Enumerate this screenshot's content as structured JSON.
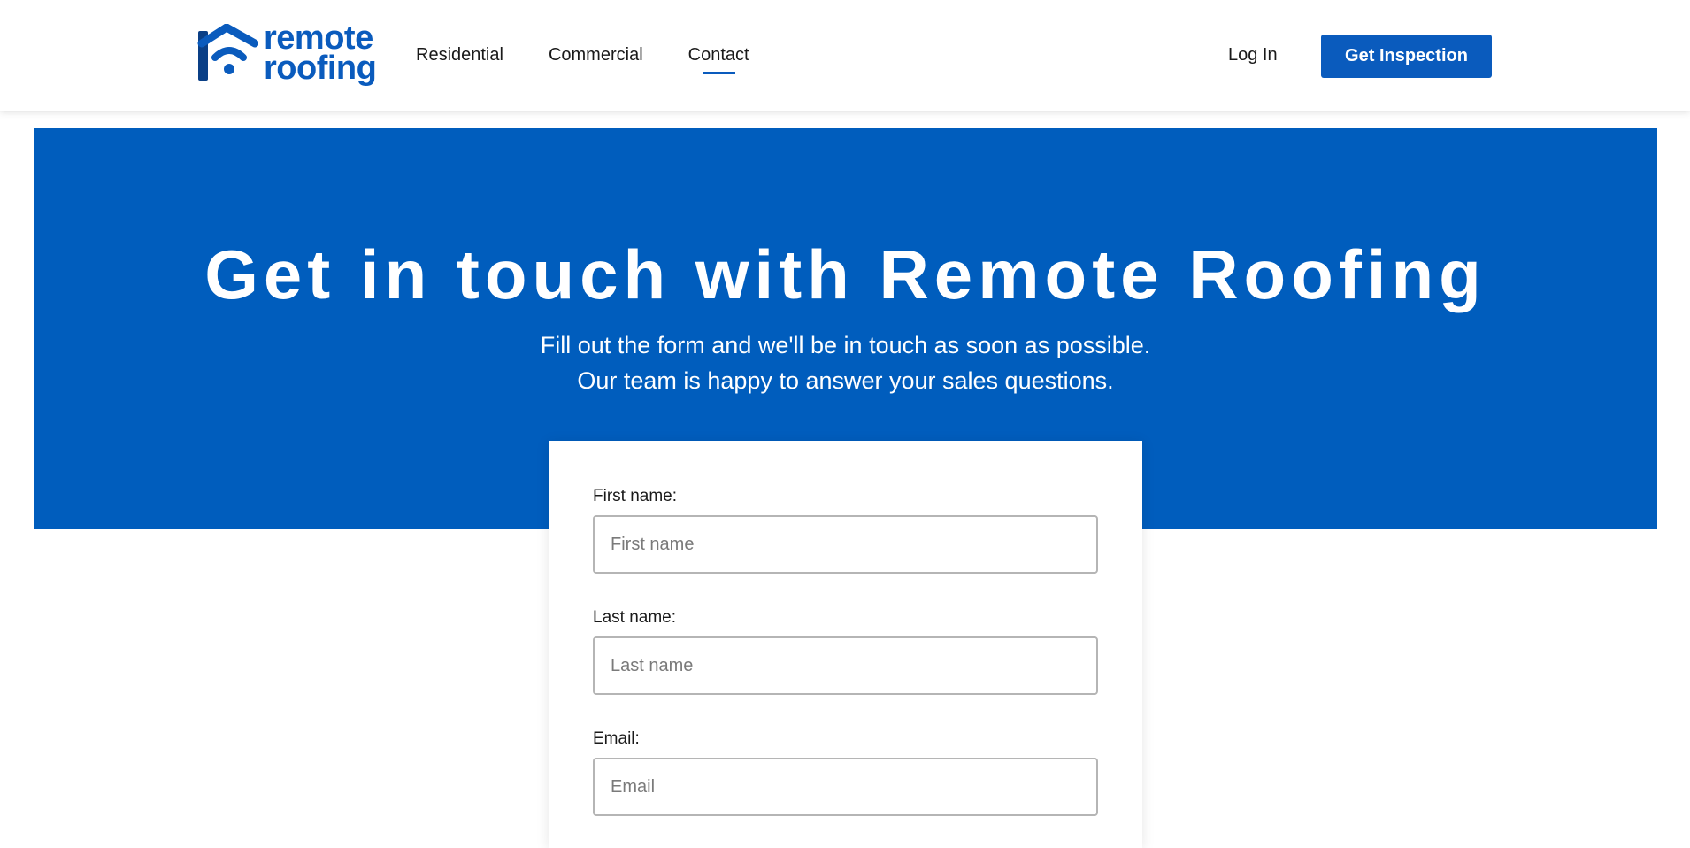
{
  "header": {
    "logo": {
      "line1": "remote",
      "line2": "roofing",
      "icon": "house-wifi-logo-icon"
    },
    "nav": [
      {
        "label": "Residential",
        "active": false
      },
      {
        "label": "Commercial",
        "active": false
      },
      {
        "label": "Contact",
        "active": true
      }
    ],
    "login_label": "Log In",
    "cta_label": "Get Inspection"
  },
  "hero": {
    "title": "Get in touch with Remote Roofing",
    "subtitle_line1": "Fill out the form and we'll be in touch as soon as possible.",
    "subtitle_line2": "Our team is happy to answer your sales questions."
  },
  "form": {
    "first_name": {
      "label": "First name:",
      "placeholder": "First name",
      "value": ""
    },
    "last_name": {
      "label": "Last name:",
      "placeholder": "Last name",
      "value": ""
    },
    "email": {
      "label": "Email:",
      "placeholder": "Email",
      "value": ""
    }
  },
  "colors": {
    "brand_blue": "#005dbd",
    "button_blue": "#0a5bbd",
    "text": "#1a1a1a"
  }
}
